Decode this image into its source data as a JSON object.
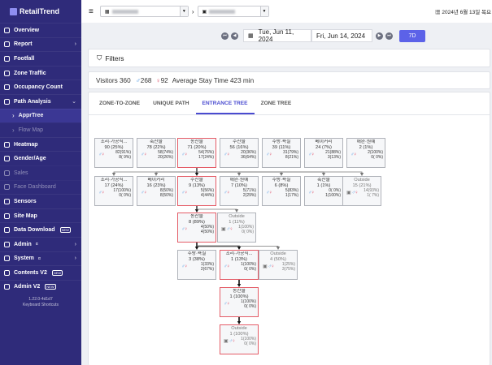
{
  "app": {
    "brand": "RetailTrend",
    "version": "1.22.0-4d1d7",
    "shortcuts": "Keyboard Shortcuts"
  },
  "sidebar": [
    {
      "label": "Overview",
      "icon": "eye-icon",
      "kind": "nav",
      "active": false
    },
    {
      "label": "Report",
      "icon": "document-icon",
      "kind": "nav",
      "chev": "›"
    },
    {
      "label": "Footfall",
      "icon": "footfall-icon",
      "kind": "nav"
    },
    {
      "label": "Zone Traffic",
      "icon": "traffic-icon",
      "kind": "nav"
    },
    {
      "label": "Occupancy Count",
      "icon": "occupancy-icon",
      "kind": "nav"
    },
    {
      "label": "Path Analysis",
      "icon": "path-icon",
      "kind": "nav",
      "chev": "⌄"
    },
    {
      "label": "ApprTree",
      "icon": "chevron-right-icon",
      "kind": "sub",
      "active": true
    },
    {
      "label": "Flow Map",
      "icon": "chevron-right-icon",
      "kind": "subdim"
    },
    {
      "label": "Heatmap",
      "icon": "heatmap-icon",
      "kind": "nav"
    },
    {
      "label": "Gender/Age",
      "icon": "people-icon",
      "kind": "nav"
    },
    {
      "label": "Sales",
      "icon": "sales-icon",
      "kind": "dim"
    },
    {
      "label": "Face Dashboard",
      "icon": "face-icon",
      "kind": "dim"
    },
    {
      "label": "Sensors",
      "icon": "sensor-icon",
      "kind": "nav"
    },
    {
      "label": "Site Map",
      "icon": "map-icon",
      "kind": "nav"
    },
    {
      "label": "Data Download",
      "icon": "download-icon",
      "kind": "nav",
      "badge": "NEW"
    },
    {
      "label": "Admin",
      "icon": "admin-icon",
      "kind": "nav",
      "sup": "α",
      "chev": "›"
    },
    {
      "label": "System",
      "icon": "system-icon",
      "kind": "nav",
      "sup": "α",
      "chev": "›"
    },
    {
      "label": "Contents V2",
      "icon": "contents-icon",
      "kind": "nav",
      "badge": "NEW"
    },
    {
      "label": "Admin V2",
      "icon": "admin-icon",
      "kind": "nav",
      "badge": "NEW"
    }
  ],
  "top": {
    "menu_icon": "≡",
    "sep": "›",
    "date": "2024년 6월 13일 목요"
  },
  "datebar": {
    "start": "Tue, Jun 11, 2024",
    "end": "Fri, Jun 14, 2024",
    "range_btn": "7D"
  },
  "filters": {
    "label": "Filters"
  },
  "stats": {
    "visitors": "Visitors 360",
    "male": "268",
    "female": "92",
    "stay": "Average Stay Time 423 min"
  },
  "tabs": [
    {
      "label": "ZONE-TO-ZONE",
      "on": false
    },
    {
      "label": "UNIQUE PATH",
      "on": false
    },
    {
      "label": "ENTRANCE TREE",
      "on": true
    },
    {
      "label": "ZONE TREE",
      "on": false
    }
  ],
  "tree": {
    "nodes": [
      {
        "name": "조리·가공식...",
        "count": "90 (25%)",
        "m": "82(91%)",
        "f": "8( 9%)",
        "hl": false
      },
      {
        "name": "축산물",
        "count": "78 (22%)",
        "m": "58(74%)",
        "f": "20(26%)",
        "hl": false
      },
      {
        "name": "농산물",
        "count": "71 (20%)",
        "m": "54(76%)",
        "f": "17(24%)",
        "hl": true
      },
      {
        "name": "수산물",
        "count": "56 (16%)",
        "m": "20(36%)",
        "f": "36(64%)",
        "hl": false
      },
      {
        "name": "주방·욕실",
        "count": "39 (11%)",
        "m": "31(79%)",
        "f": "8(21%)",
        "hl": false
      },
      {
        "name": "베이커리",
        "count": "24 (7%)",
        "m": "21(88%)",
        "f": "3(13%)",
        "hl": false
      },
      {
        "name": "애완·원예",
        "count": "2 (1%)",
        "m": "2(100%)",
        "f": "0(  0%)",
        "hl": false
      },
      {
        "name": "조리·가공식...",
        "count": "17 (24%)",
        "m": "17(100%)",
        "f": "0(  0%)",
        "hl": false
      },
      {
        "name": "베이커리",
        "count": "16 (23%)",
        "m": "8(50%)",
        "f": "8(50%)",
        "hl": false
      },
      {
        "name": "수산물",
        "count": "9 (13%)",
        "m": "5(56%)",
        "f": "4(44%)",
        "hl": true
      },
      {
        "name": "애완·원예",
        "count": "7 (10%)",
        "m": "5(71%)",
        "f": "2(29%)",
        "hl": false
      },
      {
        "name": "주방·욕실",
        "count": "6 (8%)",
        "m": "5(83%)",
        "f": "1(17%)",
        "hl": false
      },
      {
        "name": "축산물",
        "count": "1 (1%)",
        "m": "0(  0%)",
        "f": "1(100%)",
        "hl": false
      },
      {
        "name": "Outside",
        "count": "15 (21%)",
        "m": "14(93%)",
        "f": "1( 7%)",
        "hl": false,
        "out": true
      },
      {
        "name": "농산물",
        "count": "8 (89%)",
        "m": "4(50%)",
        "f": "4(50%)",
        "hl": true
      },
      {
        "name": "Outside",
        "count": "1 (11%)",
        "m": "1(100%)",
        "f": "0(  0%)",
        "hl": false,
        "out": true
      },
      {
        "name": "주방·욕실",
        "count": "3 (38%)",
        "m": "1(33%)",
        "f": "2(67%)",
        "hl": false
      },
      {
        "name": "조리·가공식...",
        "count": "1 (13%)",
        "m": "1(100%)",
        "f": "0(  0%)",
        "hl": true
      },
      {
        "name": "Outside",
        "count": "4 (50%)",
        "m": "1(25%)",
        "f": "3(75%)",
        "hl": false,
        "out": true
      },
      {
        "name": "농산물",
        "count": "1 (100%)",
        "m": "1(100%)",
        "f": "0(  0%)",
        "hl": true
      },
      {
        "name": "Outside",
        "count": "1 (100%)",
        "m": "1(100%)",
        "f": "0(  0%)",
        "hl": true,
        "out": true
      }
    ]
  },
  "colors": {
    "sidebar": "#2f2b7a",
    "accent": "#5c62e8",
    "highlight": "#e45c67",
    "male": "#3d8fe0",
    "female": "#e0506a"
  }
}
